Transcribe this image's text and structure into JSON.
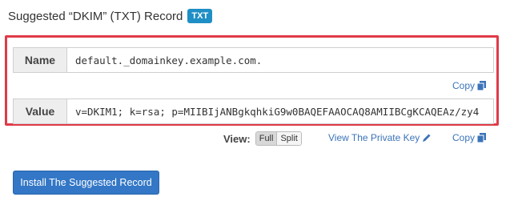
{
  "header": {
    "title": "Suggested “DKIM” (TXT) Record",
    "badge": "TXT"
  },
  "record": {
    "name_label": "Name",
    "name_value": "default._domainkey.example.com.",
    "value_label": "Value",
    "value_value": "v=DKIM1; k=rsa; p=MIIBIjANBgkqhkiG9w0BAQEFAAOCAQ8AMIIBCgKCAQEAz/zy4",
    "copy_name_label": "Copy",
    "copy_value_label": "Copy"
  },
  "view": {
    "label": "View:",
    "options": [
      "Full",
      "Split"
    ],
    "selected": "Full",
    "private_key_link": "View The Private Key"
  },
  "actions": {
    "install_label": "Install The Suggested Record"
  },
  "colors": {
    "accent": "#3377c6",
    "badge": "#1f8fc5",
    "highlight_border": "#e03a47",
    "link": "#3b73b9"
  }
}
